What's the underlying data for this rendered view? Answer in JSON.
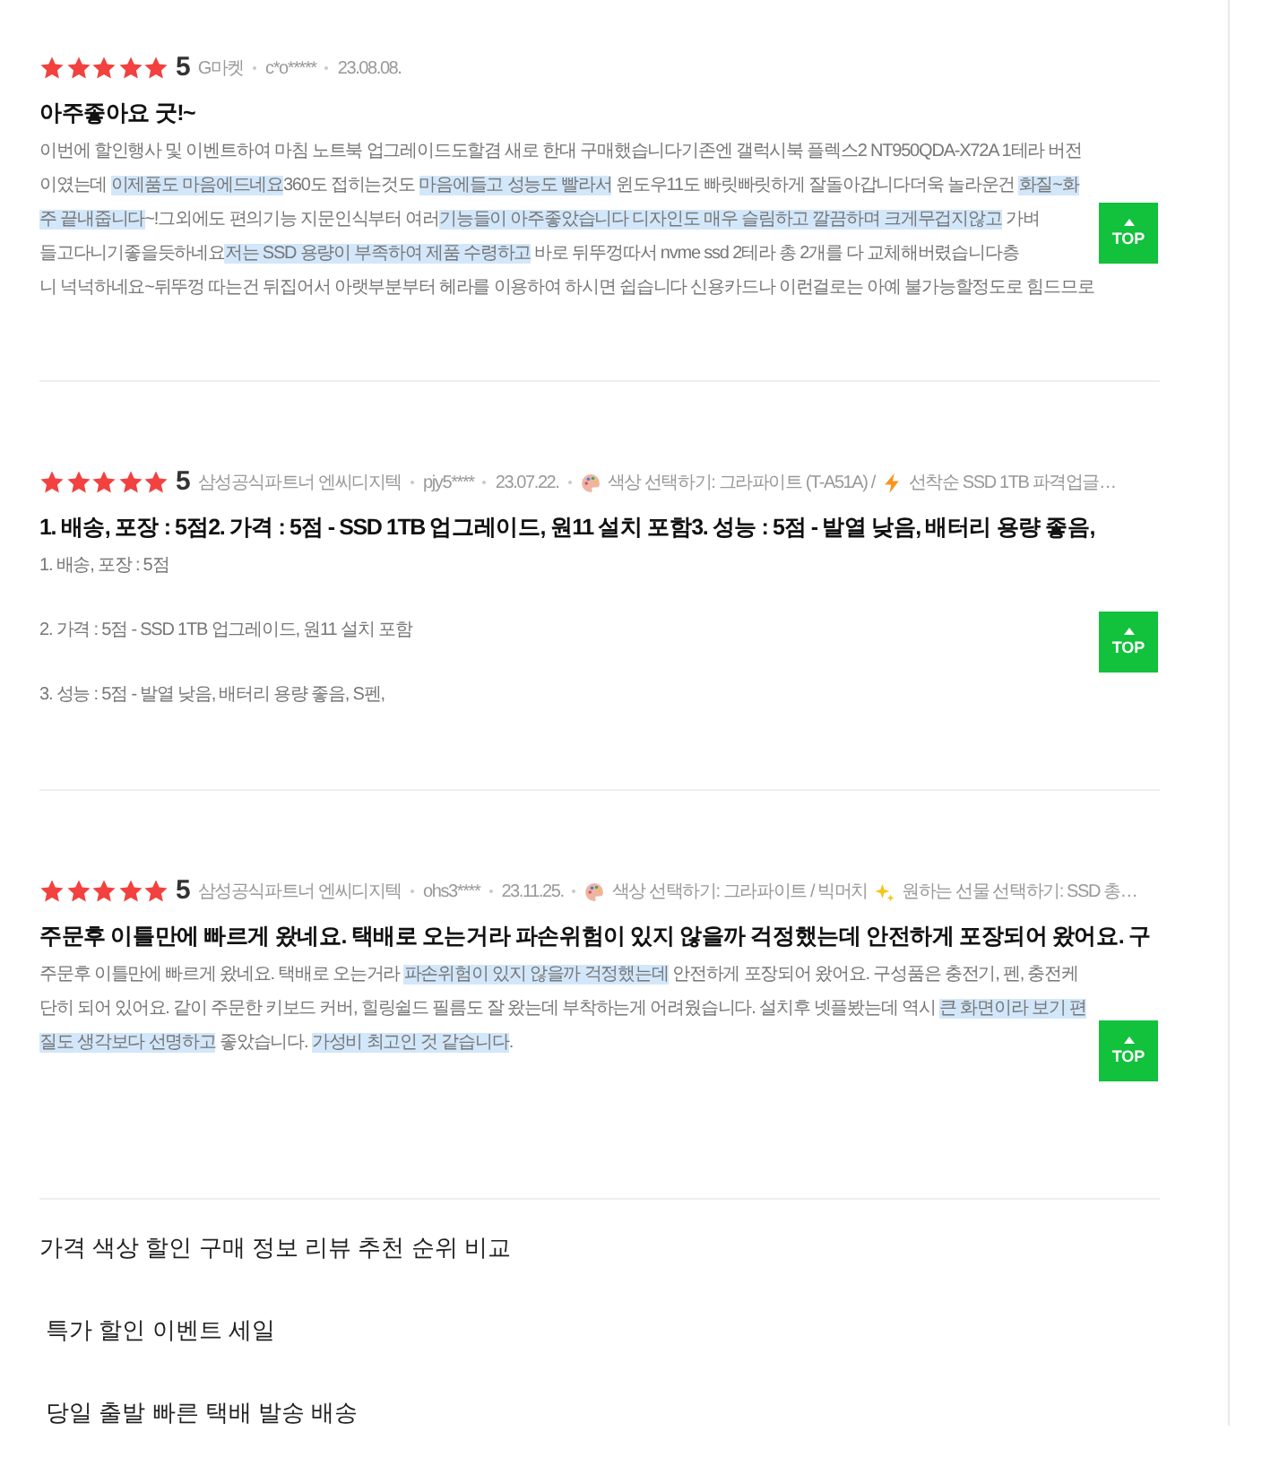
{
  "reviews": [
    {
      "stars": 5,
      "score": "5",
      "seller": "G마켓",
      "reviewer": "c*o*****",
      "date": "23.08.08.",
      "title": "아주좋아요 굿!~",
      "paragraphs": [
        {
          "lines": [
            {
              "segments": [
                {
                  "text": "이번에 할인행사 및 이벤트하여 마침 노트북 업그레이드도할겸 새로 한대 구매했습니다기존엔 갤럭시북 플렉스2 NT950QDA-X72A 1테라 버전",
                  "highlighted": false
                }
              ]
            },
            {
              "segments": [
                {
                  "text": "이였는데 ",
                  "highlighted": false
                },
                {
                  "text": "이제품도 마음에드네요",
                  "highlighted": true
                },
                {
                  "text": "360도 접히는것도 ",
                  "highlighted": false
                },
                {
                  "text": "마음에들고 성능도 빨라서",
                  "highlighted": true
                },
                {
                  "text": " 윈도우11도 빠릿빠릿하게 잘돌아갑니다더욱 놀라운건 ",
                  "highlighted": false
                },
                {
                  "text": "화질~화",
                  "highlighted": true
                }
              ]
            },
            {
              "segments": [
                {
                  "text": "주 끝내줍니다",
                  "highlighted": true
                },
                {
                  "text": "~!그외에도 편의기능 지문인식부터 여러",
                  "highlighted": false
                },
                {
                  "text": "기능들이 아주좋았습니다 디자인도 매우 슬림하고 깔끔하며 크게무겁지않고",
                  "highlighted": true
                },
                {
                  "text": " 가벼",
                  "highlighted": false
                }
              ]
            },
            {
              "segments": [
                {
                  "text": "들고다니기좋을듯하네요",
                  "highlighted": false
                },
                {
                  "text": "저는 SSD 용량이 부족하여 제품 수령하고",
                  "highlighted": true
                },
                {
                  "text": " 바로 뒤뚜껑따서 nvme ssd 2테라 총 2개를 다 교체해버렸습니다층",
                  "highlighted": false
                }
              ]
            },
            {
              "segments": [
                {
                  "text": "니 넉넉하네요~뒤뚜껑 따는건 뒤집어서 아랫부분부터 헤라를 이용하여 하시면 쉽습니다 신용카드나 이런걸로는 아예 불가능할정도로 힘드므로",
                  "highlighted": false
                }
              ]
            }
          ]
        }
      ],
      "top_button": "TOP"
    },
    {
      "stars": 5,
      "score": "5",
      "seller": "삼성공식파트너 엔씨디지텍",
      "reviewer": "pjy5****",
      "date": "23.07.22.",
      "options": [
        {
          "kind": "color",
          "label": "색상 선택하기: 그라파이트 (T-A51A) /"
        },
        {
          "kind": "promo",
          "label": "선착순 SSD 1TB 파격업글…"
        }
      ],
      "title": "1. 배송, 포장 : 5점2. 가격 : 5점 - SSD 1TB 업그레이드, 원11 설치 포함3. 성능 : 5점 - 발열 낮음, 배터리 용량 좋음,",
      "paragraphs": [
        {
          "lines": [
            {
              "segments": [
                {
                  "text": "1. 배송, 포장 : 5점",
                  "highlighted": false
                }
              ]
            }
          ]
        },
        {
          "lines": [
            {
              "segments": [
                {
                  "text": "2. 가격 : 5점 - SSD 1TB 업그레이드, 원11 설치 포함",
                  "highlighted": false
                }
              ]
            }
          ]
        },
        {
          "lines": [
            {
              "segments": [
                {
                  "text": "3. 성능 : 5점 - 발열 낮음, 배터리 용량 좋음, S펜,",
                  "highlighted": false
                }
              ]
            }
          ]
        }
      ],
      "top_button": "TOP"
    },
    {
      "stars": 5,
      "score": "5",
      "seller": "삼성공식파트너 엔씨디지텍",
      "reviewer": "ohs3****",
      "date": "23.11.25.",
      "options": [
        {
          "kind": "color",
          "label": "색상 선택하기: 그라파이트 / 빅머치"
        },
        {
          "kind": "gift",
          "label": "원하는 선물 선택하기: SSD 총…"
        }
      ],
      "title": "주문후 이틀만에 빠르게 왔네요. 택배로 오는거라 파손위험이 있지 않을까 걱정했는데 안전하게 포장되어 왔어요. 구",
      "paragraphs": [
        {
          "lines": [
            {
              "segments": [
                {
                  "text": "주문후 이틀만에 빠르게 왔네요. 택배로 오는거라 ",
                  "highlighted": false
                },
                {
                  "text": "파손위험이 있지 않을까 걱정했는데",
                  "highlighted": true
                },
                {
                  "text": " 안전하게 포장되어 왔어요. 구성품은 충전기, 펜, 충전케",
                  "highlighted": false
                }
              ]
            },
            {
              "segments": [
                {
                  "text": "단히 되어 있어요. 같이 주문한 키보드 커버, 힐링쉴드 필름도 잘 왔는데 부착하는게 어려웠습니다. 설치후 넷플봤는데 역시 ",
                  "highlighted": false
                },
                {
                  "text": "큰 화면이라 보기 편",
                  "highlighted": true
                }
              ]
            },
            {
              "segments": [
                {
                  "text": "질도 생각보다 선명하고",
                  "highlighted": true
                },
                {
                  "text": " 좋았습니다. ",
                  "highlighted": false
                },
                {
                  "text": "가성비 최고인 것 같습니다",
                  "highlighted": true
                },
                {
                  "text": ".",
                  "highlighted": false
                }
              ]
            }
          ]
        }
      ],
      "top_button": "TOP"
    }
  ],
  "keywords": [
    "가격 색상 할인 구매 정보 리뷰 추천 순위 비교",
    " 특가 할인 이벤트 세일",
    " 당일 출발 빠른 택배 발송 배송"
  ]
}
